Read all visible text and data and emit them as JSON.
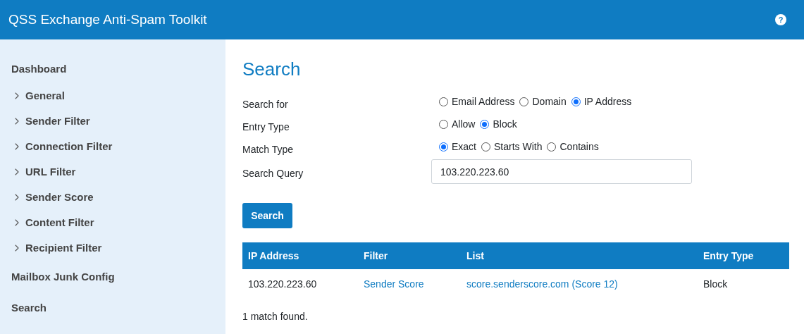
{
  "header": {
    "title": "QSS Exchange Anti-Spam Toolkit",
    "help": "?"
  },
  "sidebar": {
    "items": [
      {
        "label": "Dashboard",
        "kind": "link"
      },
      {
        "label": "General",
        "kind": "group"
      },
      {
        "label": "Sender Filter",
        "kind": "group"
      },
      {
        "label": "Connection Filter",
        "kind": "group"
      },
      {
        "label": "URL Filter",
        "kind": "group"
      },
      {
        "label": "Sender Score",
        "kind": "group"
      },
      {
        "label": "Content Filter",
        "kind": "group"
      },
      {
        "label": "Recipient Filter",
        "kind": "group"
      },
      {
        "label": "Mailbox Junk Config",
        "kind": "link"
      },
      {
        "label": "Search",
        "kind": "link"
      }
    ]
  },
  "page_title": "Search",
  "form": {
    "rows": [
      {
        "label": "Search for",
        "kind": "radios",
        "options": [
          {
            "label": "Email Address",
            "selected": false
          },
          {
            "label": "Domain",
            "selected": false
          },
          {
            "label": "IP Address",
            "selected": true
          }
        ]
      },
      {
        "label": "Entry Type",
        "kind": "radios",
        "options": [
          {
            "label": "Allow",
            "selected": false
          },
          {
            "label": "Block",
            "selected": true
          }
        ]
      },
      {
        "label": "Match Type",
        "kind": "radios",
        "options": [
          {
            "label": "Exact",
            "selected": true
          },
          {
            "label": "Starts With",
            "selected": false
          },
          {
            "label": "Contains",
            "selected": false
          }
        ]
      },
      {
        "label": "Search Query",
        "kind": "input",
        "value": "103.220.223.60"
      }
    ],
    "button": "Search"
  },
  "table": {
    "columns": [
      "IP Address",
      "Filter",
      "List",
      "Entry Type"
    ],
    "rows": [
      [
        {
          "text": "103.220.223.60",
          "kind": "text"
        },
        {
          "text": "Sender Score",
          "kind": "link"
        },
        {
          "text": "score.senderscore.com (Score 12)",
          "kind": "link"
        },
        {
          "text": "Block",
          "kind": "text"
        }
      ]
    ]
  },
  "status": "1 match found."
}
